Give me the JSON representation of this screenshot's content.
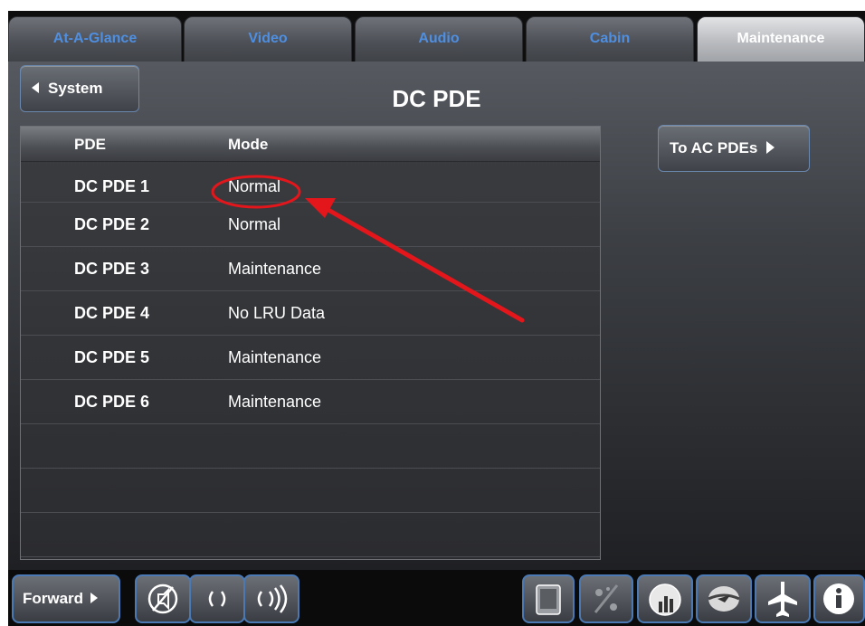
{
  "tabs": [
    {
      "label": "At-A-Glance",
      "active": false
    },
    {
      "label": "Video",
      "active": false
    },
    {
      "label": "Audio",
      "active": false
    },
    {
      "label": "Cabin",
      "active": false
    },
    {
      "label": "Maintenance",
      "active": true
    }
  ],
  "nav": {
    "back_label": "System",
    "title": "DC PDE",
    "forward_label": "To AC PDEs"
  },
  "table": {
    "headers": [
      "PDE",
      "Mode"
    ],
    "rows": [
      {
        "pde": "DC PDE 1",
        "mode": "Normal"
      },
      {
        "pde": "DC PDE 2",
        "mode": "Normal"
      },
      {
        "pde": "DC PDE 3",
        "mode": "Maintenance"
      },
      {
        "pde": "DC PDE 4",
        "mode": "No LRU Data"
      },
      {
        "pde": "DC PDE 5",
        "mode": "Maintenance"
      },
      {
        "pde": "DC PDE 6",
        "mode": "Maintenance"
      }
    ]
  },
  "bottom": {
    "zone_label": "Forward"
  },
  "colors": {
    "tab_text": "#4e8fe2",
    "annotation": "#e3161b",
    "button_border": "#4a79b4"
  },
  "icons": [
    "mute-icon",
    "volume-low-icon",
    "volume-high-icon",
    "tablet-icon",
    "weather-icon",
    "stats-globe-icon",
    "moving-map-icon",
    "aircraft-icon",
    "info-icon"
  ]
}
